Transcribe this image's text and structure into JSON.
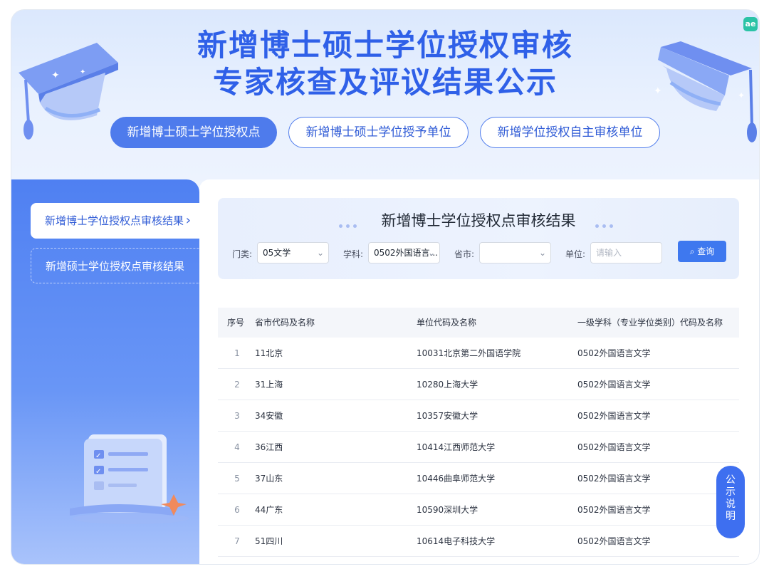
{
  "hero": {
    "title_line1": "新增博士硕士学位授权审核",
    "title_line2": "专家核查及评议结果公示",
    "badge": "ae"
  },
  "tabs": [
    {
      "label": "新增博士硕士学位授权点",
      "active": true
    },
    {
      "label": "新增博士硕士学位授予单位",
      "active": false
    },
    {
      "label": "新增学位授权自主审核单位",
      "active": false
    }
  ],
  "sidebar": {
    "items": [
      {
        "label": "新增博士学位授权点审核结果",
        "active": true
      },
      {
        "label": "新增硕士学位授权点审核结果",
        "active": false
      }
    ]
  },
  "filter": {
    "title": "新增博士学位授权点审核结果",
    "category_label": "门类:",
    "category_value": "05文学",
    "subject_label": "学科:",
    "subject_value": "0502外国语言...",
    "province_label": "省市:",
    "province_value": "",
    "unit_label": "单位:",
    "unit_placeholder": "请输入",
    "query_label": "查询"
  },
  "table": {
    "headers": [
      "序号",
      "省市代码及名称",
      "单位代码及名称",
      "一级学科（专业学位类别）代码及名称"
    ],
    "rows": [
      [
        "1",
        "11北京",
        "10031北京第二外国语学院",
        "0502外国语言文学"
      ],
      [
        "2",
        "31上海",
        "10280上海大学",
        "0502外国语言文学"
      ],
      [
        "3",
        "34安徽",
        "10357安徽大学",
        "0502外国语言文学"
      ],
      [
        "4",
        "36江西",
        "10414江西师范大学",
        "0502外国语言文学"
      ],
      [
        "5",
        "37山东",
        "10446曲阜师范大学",
        "0502外国语言文学"
      ],
      [
        "6",
        "44广东",
        "10590深圳大学",
        "0502外国语言文学"
      ],
      [
        "7",
        "51四川",
        "10614电子科技大学",
        "0502外国语言文学"
      ]
    ]
  },
  "notice": {
    "chars": [
      "公",
      "示",
      "说",
      "明"
    ]
  },
  "colors": {
    "accent": "#4e7bec",
    "title": "#2f60e8",
    "button": "#3e78ef"
  }
}
